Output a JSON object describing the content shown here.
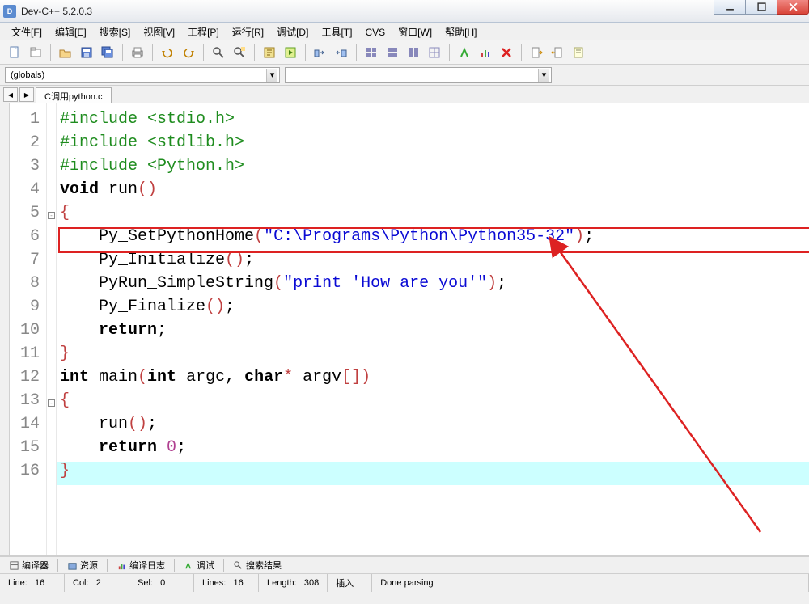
{
  "window": {
    "title": "Dev-C++ 5.2.0.3"
  },
  "menu": [
    "文件[F]",
    "编辑[E]",
    "搜索[S]",
    "视图[V]",
    "工程[P]",
    "运行[R]",
    "调试[D]",
    "工具[T]",
    "CVS",
    "窗口[W]",
    "帮助[H]"
  ],
  "combos": {
    "globals": "(globals)",
    "second": ""
  },
  "tab": {
    "filename": "C调用python.c"
  },
  "code": {
    "lines": [
      {
        "n": 1,
        "seg": [
          [
            "pp",
            "#include <stdio.h>"
          ]
        ]
      },
      {
        "n": 2,
        "seg": [
          [
            "pp",
            "#include <stdlib.h>"
          ]
        ]
      },
      {
        "n": 3,
        "seg": [
          [
            "pp",
            "#include <Python.h>"
          ]
        ]
      },
      {
        "n": 4,
        "seg": [
          [
            "kw",
            "void"
          ],
          [
            "fn",
            " run"
          ],
          [
            "punct",
            "()"
          ]
        ]
      },
      {
        "n": 5,
        "fold": "open",
        "seg": [
          [
            "punct",
            "{"
          ]
        ]
      },
      {
        "n": 6,
        "seg": [
          [
            "fn",
            "    Py_SetPythonHome"
          ],
          [
            "punct",
            "("
          ],
          [
            "str",
            "\"C:\\Programs\\Python\\Python35-32\""
          ],
          [
            "punct",
            ")"
          ],
          [
            "fn",
            ";"
          ]
        ]
      },
      {
        "n": 7,
        "seg": [
          [
            "fn",
            "    Py_Initialize"
          ],
          [
            "punct",
            "()"
          ],
          [
            "fn",
            ";"
          ]
        ]
      },
      {
        "n": 8,
        "seg": [
          [
            "fn",
            "    PyRun_SimpleString"
          ],
          [
            "punct",
            "("
          ],
          [
            "str",
            "\"print 'How are you'\""
          ],
          [
            "punct",
            ")"
          ],
          [
            "fn",
            ";"
          ]
        ]
      },
      {
        "n": 9,
        "seg": [
          [
            "fn",
            "    Py_Finalize"
          ],
          [
            "punct",
            "()"
          ],
          [
            "fn",
            ";"
          ]
        ]
      },
      {
        "n": 10,
        "seg": [
          [
            "fn",
            "    "
          ],
          [
            "kw",
            "return"
          ],
          [
            "fn",
            ";"
          ]
        ]
      },
      {
        "n": 11,
        "seg": [
          [
            "punct",
            "}"
          ]
        ]
      },
      {
        "n": 12,
        "seg": [
          [
            "kw",
            "int"
          ],
          [
            "fn",
            " main"
          ],
          [
            "punct",
            "("
          ],
          [
            "kw",
            "int"
          ],
          [
            "fn",
            " argc, "
          ],
          [
            "kw",
            "char"
          ],
          [
            "punct",
            "*"
          ],
          [
            "fn",
            " argv"
          ],
          [
            "punct",
            "[])"
          ]
        ]
      },
      {
        "n": 13,
        "fold": "open",
        "seg": [
          [
            "punct",
            "{"
          ]
        ]
      },
      {
        "n": 14,
        "seg": [
          [
            "fn",
            "    run"
          ],
          [
            "punct",
            "()"
          ],
          [
            "fn",
            ";"
          ]
        ]
      },
      {
        "n": 15,
        "seg": [
          [
            "fn",
            "    "
          ],
          [
            "kw",
            "return"
          ],
          [
            "fn",
            " "
          ],
          [
            "num",
            "0"
          ],
          [
            "fn",
            ";"
          ]
        ]
      },
      {
        "n": 16,
        "hl": true,
        "seg": [
          [
            "punct",
            "}"
          ]
        ]
      }
    ]
  },
  "bottom_tabs": [
    "编译器",
    "资源",
    "编译日志",
    "调试",
    "搜索结果"
  ],
  "status": {
    "line_lbl": "Line:",
    "line": "16",
    "col_lbl": "Col:",
    "col": "2",
    "sel_lbl": "Sel:",
    "sel": "0",
    "lines_lbl": "Lines:",
    "lines": "16",
    "len_lbl": "Length:",
    "len": "308",
    "mode": "插入",
    "parse": "Done parsing"
  }
}
